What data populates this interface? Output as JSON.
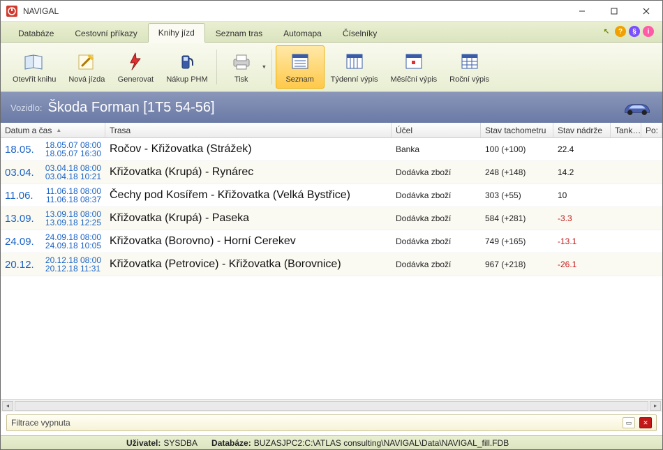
{
  "window": {
    "title": "NAVIGAL"
  },
  "menu": {
    "items": [
      "Databáze",
      "Cestovní příkazy",
      "Knihy jízd",
      "Seznam tras",
      "Automapa",
      "Číselníky"
    ],
    "active": 2
  },
  "toolbar": {
    "groups": [
      [
        "Otevřít knihu",
        "Nová jízda",
        "Generovat",
        "Nákup PHM"
      ],
      [
        "Tisk"
      ],
      [
        "Seznam",
        "Týdenní výpis",
        "Měsíční výpis",
        "Roční výpis"
      ]
    ],
    "active": "Seznam"
  },
  "vehicle": {
    "label": "Vozidlo:",
    "value": "Škoda Forman [1T5 54-56]"
  },
  "columns": {
    "date": "Datum a čas",
    "trasa": "Trasa",
    "ucel": "Účel",
    "odo": "Stav tachometru",
    "tank": "Stav nádrže",
    "t2": "Tank…",
    "po": "Po:"
  },
  "rows": [
    {
      "day": "18.05.",
      "t1": "18.05.07 08:00",
      "t2": "18.05.07 16:30",
      "trasa": "Ročov - Křižovatka (Strážek)",
      "ucel": "Banka",
      "odo": "100 (+100)",
      "tank": "22.4",
      "neg": false
    },
    {
      "day": "03.04.",
      "t1": "03.04.18 08:00",
      "t2": "03.04.18 10:21",
      "trasa": "Křižovatka (Krupá) - Rynárec",
      "ucel": "Dodávka zboží",
      "odo": "248 (+148)",
      "tank": "14.2",
      "neg": false
    },
    {
      "day": "11.06.",
      "t1": "11.06.18 08:00",
      "t2": "11.06.18 08:37",
      "trasa": "Čechy pod Kosířem - Křižovatka (Velká Bystřice)",
      "ucel": "Dodávka zboží",
      "odo": "303 (+55)",
      "tank": "10",
      "neg": false
    },
    {
      "day": "13.09.",
      "t1": "13.09.18 08:00",
      "t2": "13.09.18 12:25",
      "trasa": "Křižovatka (Krupá) - Paseka",
      "ucel": "Dodávka zboží",
      "odo": "584 (+281)",
      "tank": "-3.3",
      "neg": true
    },
    {
      "day": "24.09.",
      "t1": "24.09.18 08:00",
      "t2": "24.09.18 10:05",
      "trasa": "Křižovatka (Borovno) - Horní Cerekev",
      "ucel": "Dodávka zboží",
      "odo": "749 (+165)",
      "tank": "-13.1",
      "neg": true
    },
    {
      "day": "20.12.",
      "t1": "20.12.18 08:00",
      "t2": "20.12.18 11:31",
      "trasa": "Křižovatka (Petrovice) - Křižovatka (Borovnice)",
      "ucel": "Dodávka zboží",
      "odo": "967 (+218)",
      "tank": "-26.1",
      "neg": true
    }
  ],
  "filter": {
    "text": "Filtrace vypnuta"
  },
  "status": {
    "user_label": "Uživatel:",
    "user": "SYSDBA",
    "db_label": "Databáze:",
    "db": "BUZASJPC2:C:\\ATLAS consulting\\NAVIGAL\\Data\\NAVIGAL_fill.FDB"
  },
  "help_colors": [
    "#a0c030",
    "#f0a000",
    "#7a4fff",
    "#ff5aa8"
  ]
}
